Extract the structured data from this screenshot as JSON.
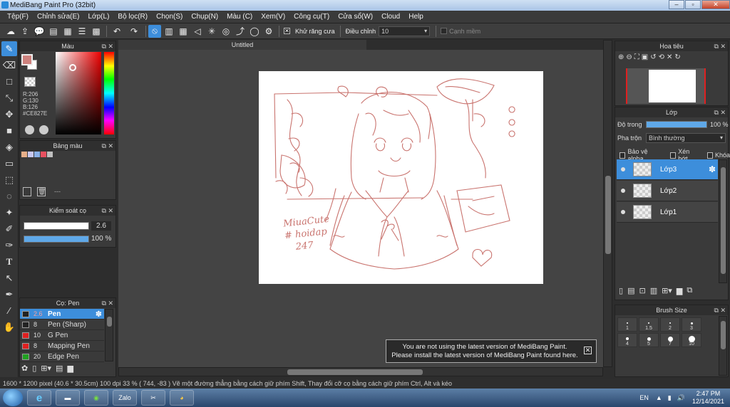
{
  "window": {
    "title": "MediBang Paint Pro (32bit)"
  },
  "menu": [
    "Tệp(F)",
    "Chỉnh sửa(E)",
    "Lớp(L)",
    "Bộ lọc(R)",
    "Chọn(S)",
    "Chụp(N)",
    "Màu (C)",
    "Xem(V)",
    "Công cụ(T)",
    "Cửa sổ(W)",
    "Cloud",
    "Help"
  ],
  "toolbar": {
    "antialias_label": "Khử răng cưa",
    "correction_label": "Điều chỉnh",
    "correction_value": "10",
    "edge_label": "Cạnh mềm"
  },
  "color_panel": {
    "title": "Màu",
    "r": "R:206",
    "g": "G:130",
    "b": "B:126",
    "hex": "#CE827E",
    "fg_color": "#ce827e"
  },
  "palette_panel": {
    "title": "Bảng màu",
    "placeholder": "---",
    "swatches": [
      "#e8b08a",
      "#c8c8f0",
      "#8ab0e8",
      "#e85060",
      "#c0c0c0"
    ]
  },
  "brush_control": {
    "title": "Kiểm soát cọ",
    "size": "2.6",
    "opacity": "100 %",
    "opacity_fraction": 1.0,
    "size_fraction": 1.0
  },
  "brush_panel": {
    "title": "Cọ: Pen",
    "brushes": [
      {
        "size": "2.6",
        "name": "Pen",
        "color": "#222222"
      },
      {
        "size": "8",
        "name": "Pen (Sharp)",
        "color": "#222222"
      },
      {
        "size": "10",
        "name": "G Pen",
        "color": "#e02020"
      },
      {
        "size": "8",
        "name": "Mapping Pen",
        "color": "#e02020"
      },
      {
        "size": "20",
        "name": "Edge Pen",
        "color": "#20a020"
      }
    ]
  },
  "canvas": {
    "tab_title": "Untitled"
  },
  "navigator": {
    "title": "Hoa tiêu"
  },
  "layer_panel": {
    "title": "Lớp",
    "opacity_label": "Độ trong",
    "opacity_value": "100 %",
    "opacity_fraction": 1.0,
    "blend_label": "Pha trộn",
    "blend_value": "Bình thường",
    "protect_alpha": "Bảo vệ alpha",
    "clipping": "Xén bớt",
    "lock": "Khóa",
    "layers": [
      "Lớp3",
      "Lớp2",
      "Lớp1"
    ]
  },
  "brush_size_panel": {
    "title": "Brush Size",
    "sizes": [
      "1",
      "1.5",
      "2",
      "3",
      "4",
      "5",
      "7",
      "10"
    ]
  },
  "notice": {
    "line1": "You are not using the latest version of MediBang Paint.",
    "line2": "Please install the latest version of MediBang Paint found here."
  },
  "status": {
    "text": "1600 * 1200 pixel  (40.6 * 30.5cm)  100 dpi  33 %  ( 744, -83 )  Vẽ một đường thẳng bằng cách giữ phím Shift, Thay đổi cỡ cọ bằng cách giữ phím Ctrl, Alt và kéo"
  },
  "taskbar": {
    "language": "EN",
    "time": "2:47 PM",
    "date": "12/14/2021",
    "zalo": "Zalo"
  },
  "drawing": {
    "signature_line1": "MiuaCute",
    "signature_line2": "# hoidap",
    "signature_line3": "247"
  }
}
